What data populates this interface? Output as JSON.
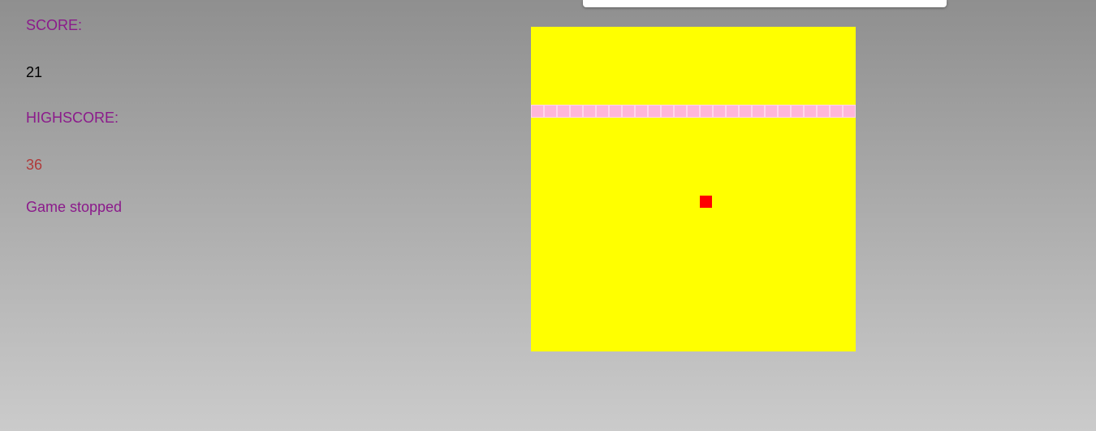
{
  "score": {
    "label": "SCORE:",
    "value": "21"
  },
  "highscore": {
    "label": "HIGHSCORE:",
    "value": "36"
  },
  "status": "Game stopped",
  "board": {
    "grid_columns": 25,
    "grid_rows": 25,
    "snake_cells": [
      [
        0,
        6
      ],
      [
        1,
        6
      ],
      [
        2,
        6
      ],
      [
        3,
        6
      ],
      [
        4,
        6
      ],
      [
        5,
        6
      ],
      [
        6,
        6
      ],
      [
        7,
        6
      ],
      [
        8,
        6
      ],
      [
        9,
        6
      ],
      [
        10,
        6
      ],
      [
        11,
        6
      ],
      [
        12,
        6
      ],
      [
        13,
        6
      ],
      [
        14,
        6
      ],
      [
        15,
        6
      ],
      [
        16,
        6
      ],
      [
        17,
        6
      ],
      [
        18,
        6
      ],
      [
        19,
        6
      ],
      [
        20,
        6
      ],
      [
        21,
        6
      ],
      [
        22,
        6
      ],
      [
        23,
        6
      ],
      [
        24,
        6
      ]
    ],
    "food_cell": [
      13,
      13
    ]
  },
  "colors": {
    "label": "#8b1a8b",
    "score_value": "#000000",
    "highscore_value": "#b03a3a",
    "status": "#8b1a8b",
    "board": "#ffff00",
    "snake_fill": "#ffb6d9",
    "snake_border": "#ffd6ea",
    "food": "#ff0000"
  }
}
